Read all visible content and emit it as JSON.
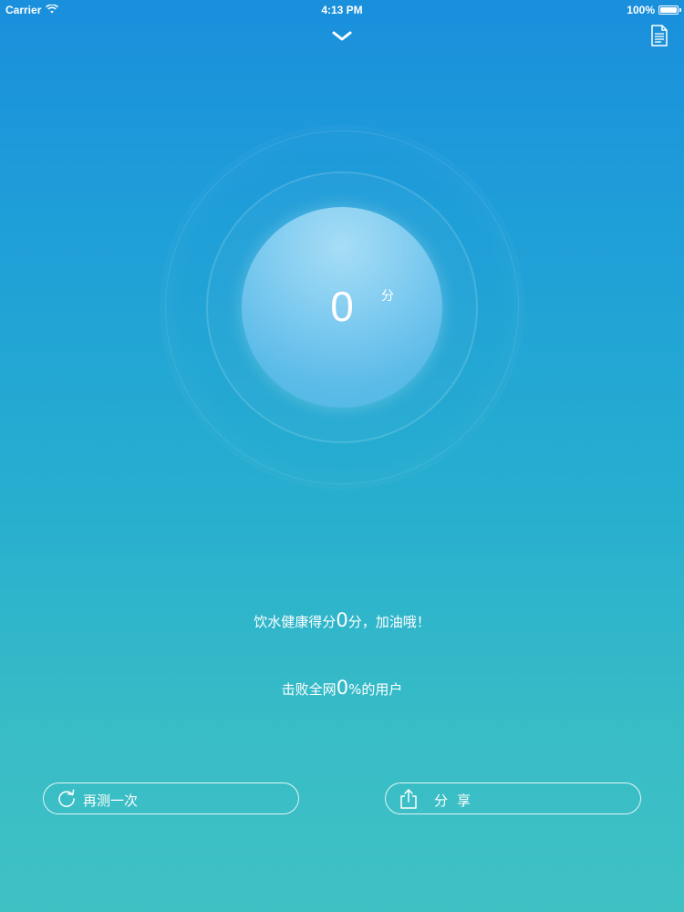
{
  "status_bar": {
    "carrier": "Carrier",
    "time": "4:13 PM",
    "battery": "100%"
  },
  "score": {
    "value": "0",
    "unit": "分"
  },
  "messages": {
    "line1_prefix": "饮水健康得分",
    "line1_value": "0",
    "line1_suffix": "分，加油哦！",
    "line2_prefix": "击败全网",
    "line2_value": "0",
    "line2_suffix": "%的用户"
  },
  "buttons": {
    "retest": "再测一次",
    "share": "分享"
  },
  "icons": {
    "collapse": "chevron-down-icon",
    "document": "document-icon",
    "retest": "refresh-icon",
    "share": "share-icon",
    "wifi": "wifi-icon"
  }
}
